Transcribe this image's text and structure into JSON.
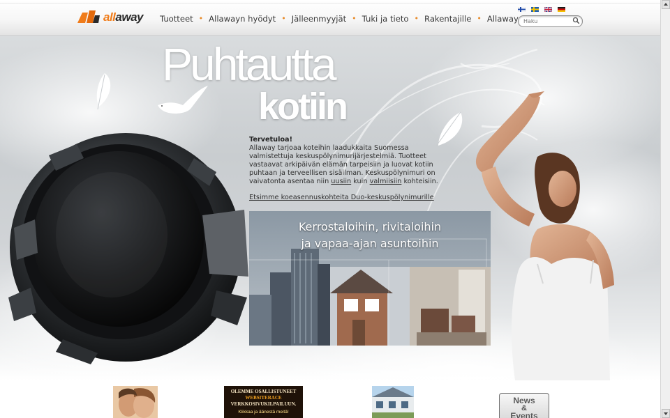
{
  "header": {
    "logo": {
      "part1": "all",
      "part2": "away"
    },
    "nav": [
      "Tuotteet",
      "Allawayn hyödyt",
      "Jälleenmyyjät",
      "Tuki ja tieto",
      "Rakentajille",
      "Allaway yrityksenä"
    ],
    "languages": [
      "fi",
      "sv",
      "en",
      "de"
    ],
    "search_placeholder": "Haku"
  },
  "hero": {
    "headline_line1": "Puhtautta",
    "headline_line2": "kotiin",
    "intro": {
      "title": "Tervetuloa!",
      "text_before": "Allaway tarjoaa koteihin laadukkaita Suomessa valmistettuja keskuspölynimurijärjestelmiä. Tuotteet vastaavat arkipäivän elämän tarpeisiin ja luovat kotiin puhtaan ja terveellisen sisäilman. Keskuspölynimuri on vaivatonta asentaa niin ",
      "link_new": "uusiin",
      "text_middle": " kuin ",
      "link_existing": "valmiisiin",
      "text_after": " kohteisiin."
    },
    "demo_link": "Etsimme koeasennuskohteita Duo-keskuspölynimurille",
    "banner": {
      "line1": "Kerrostaloihin, rivitaloihin",
      "line2": "ja vapaa-ajan asuntoihin"
    }
  },
  "bottom": {
    "websiterace_line1": "OLEMME OSALLISTUNEET",
    "websiterace_line2": "WEBSITERACE",
    "websiterace_line3": "VERKKOSIVUKILPAILUUN.",
    "websiterace_line4": "Klikkaa ja äänestä meitä!",
    "news_line1": "News",
    "news_line2": "&",
    "news_line3": "Events"
  },
  "colors": {
    "brand_orange": "#f07c1a",
    "nav_text": "#3a3a3a",
    "nav_dot": "#e88b2a"
  }
}
